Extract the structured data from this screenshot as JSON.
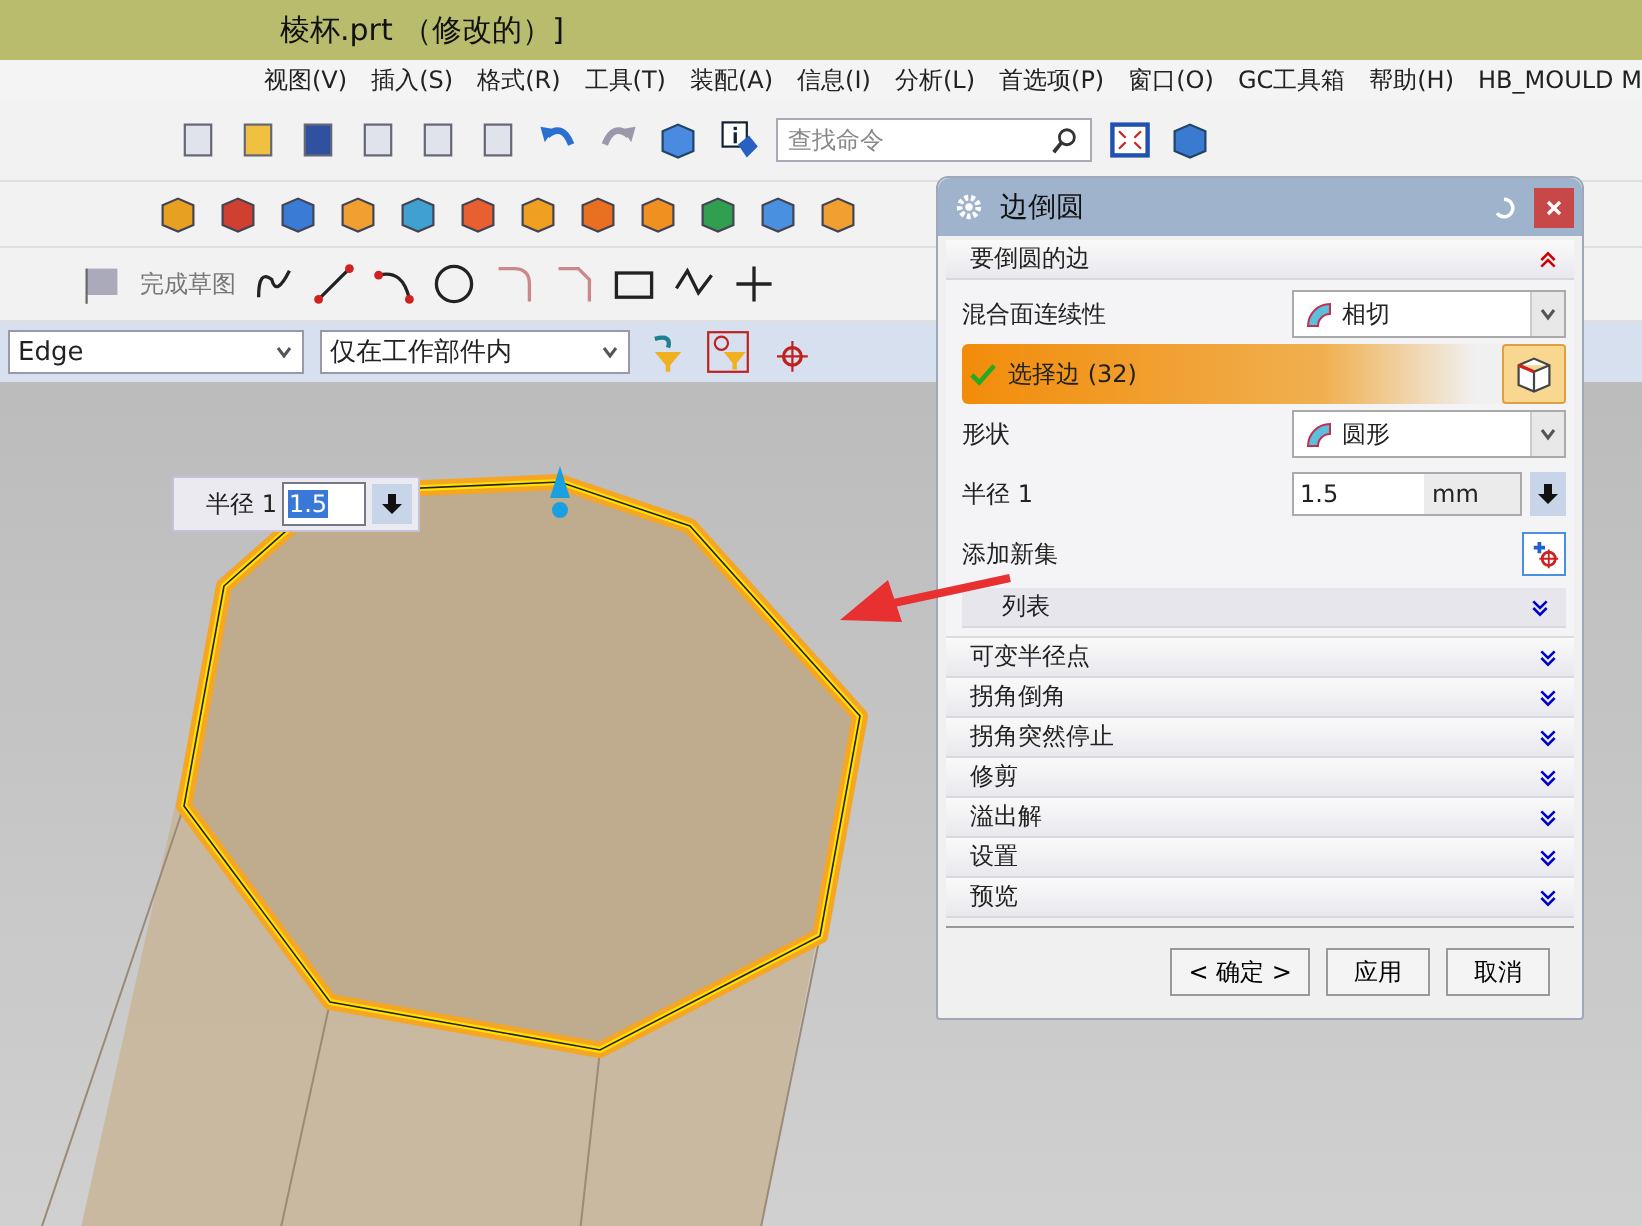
{
  "window": {
    "title": "棱杯.prt （修改的）]"
  },
  "menu": [
    "视图(V)",
    "插入(S)",
    "格式(R)",
    "工具(T)",
    "装配(A)",
    "信息(I)",
    "分析(L)",
    "首选项(P)",
    "窗口(O)",
    "GC工具箱",
    "帮助(H)",
    "HB_MOULD M"
  ],
  "toolbar": {
    "search_placeholder": "查找命令",
    "finish_sketch": "完成草图"
  },
  "selection_bar": {
    "filter": "Edge",
    "scope": "仅在工作部件内"
  },
  "radius_popup": {
    "label": "半径 1",
    "value": "1.5"
  },
  "dialog": {
    "title": "边倒圆",
    "section": {
      "title": "要倒圆的边",
      "expanded": true
    },
    "continuity": {
      "label": "混合面连续性",
      "value": "相切"
    },
    "select_edge": {
      "label": "选择边 (32)",
      "selected": true
    },
    "shape": {
      "label": "形状",
      "value": "圆形"
    },
    "radius": {
      "label": "半径 1",
      "value": "1.5",
      "unit": "mm"
    },
    "add_set": "添加新集",
    "list": {
      "title": "列表",
      "expanded": false
    },
    "groups": [
      {
        "title": "可变半径点",
        "expanded": false
      },
      {
        "title": "拐角倒角",
        "expanded": false
      },
      {
        "title": "拐角突然停止",
        "expanded": false
      },
      {
        "title": "修剪",
        "expanded": false
      },
      {
        "title": "溢出解",
        "expanded": false
      },
      {
        "title": "设置",
        "expanded": false
      },
      {
        "title": "预览",
        "expanded": false
      }
    ],
    "buttons": [
      "< 确定 >",
      "应用",
      "取消"
    ]
  }
}
